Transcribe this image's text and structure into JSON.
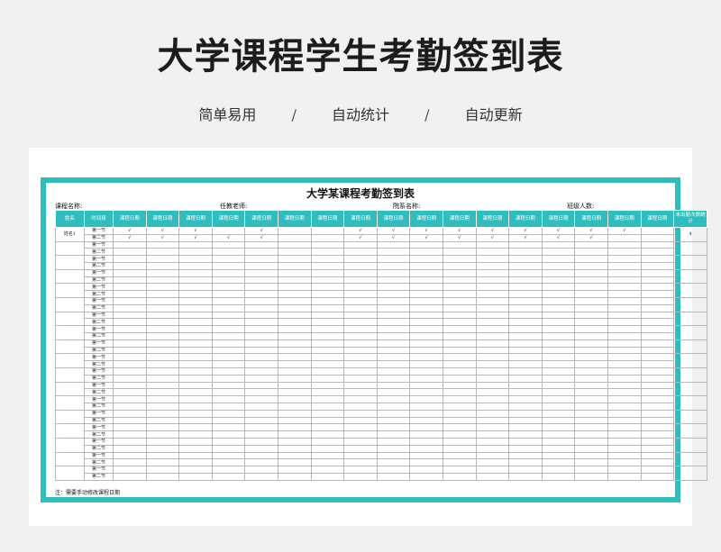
{
  "header": {
    "title": "大学课程学生考勤签到表",
    "taglines": [
      "简单易用",
      "自动统计",
      "自动更新"
    ],
    "separator": "/"
  },
  "sheet": {
    "title": "大学某课程考勤签到表",
    "meta": {
      "course": "课程名称:",
      "teacher": "任教老师:",
      "dept": "院系名称:",
      "count": "班级人数:"
    },
    "columns": {
      "name": "姓名",
      "time": "时间段",
      "date": "课程日期",
      "absent": "未出勤次数统计"
    },
    "date_column_count": 17,
    "first_student": {
      "name": "姓名1",
      "absent_count": "4",
      "row1_checks": [
        1,
        1,
        1,
        0,
        1,
        0,
        0,
        1,
        1,
        1,
        1,
        1,
        1,
        1,
        1,
        1,
        0
      ],
      "row2_checks": [
        1,
        1,
        1,
        1,
        1,
        0,
        0,
        1,
        1,
        1,
        1,
        1,
        1,
        1,
        1,
        0,
        0
      ]
    },
    "check_mark": "√",
    "period_labels": [
      "第一节",
      "第二节"
    ],
    "total_rows": 36,
    "note": "注：需要手动修改课程日期"
  }
}
